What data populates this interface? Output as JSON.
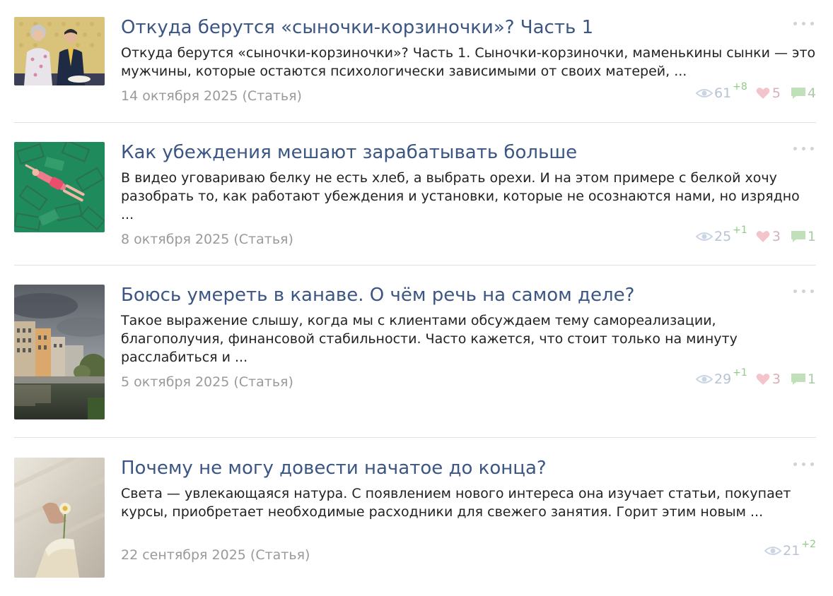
{
  "articles": [
    {
      "title": "Откуда берутся «сыночки-корзиночки»? Часть 1",
      "excerpt": "Откуда берутся «сыночки-корзиночки»? Часть 1. Сыночки-корзиночки, маменькины сынки — это мужчины, которые остаются психологически зависимыми от своих матерей, ...",
      "date": "14 октября 2025",
      "type": "(Статья)",
      "views": "61",
      "views_delta": "+8",
      "likes": "5",
      "comments": "4"
    },
    {
      "title": "Как убеждения мешают зарабатывать больше",
      "excerpt": "В видео уговариваю белку не есть хлеб, а выбрать орехи. И на этом примере с белкой хочу разобрать то, как работают убеждения и установки, которые не осознаются нами, но изрядно ...",
      "date": "8 октября 2025",
      "type": "(Статья)",
      "views": "25",
      "views_delta": "+1",
      "likes": "3",
      "comments": "1"
    },
    {
      "title": "Боюсь умереть в канаве. О чём речь на самом деле?",
      "excerpt": "Такое выражение слышу, когда мы с клиентами обсуждаем тему самореализации, благополучия, финансовой стабильности. Часто кажется, что стоит только на минуту расслабиться и ...",
      "date": "5 октября 2025",
      "type": "(Статья)",
      "views": "29",
      "views_delta": "+1",
      "likes": "3",
      "comments": "1"
    },
    {
      "title": "Почему не могу довести начатое до конца?",
      "excerpt": "Света — увлекающаяся натура. С появлением нового интереса она изучает статьи, покупает курсы, приобретает необходимые расходники для свежего занятия. Горит этим новым ...",
      "date": "22 сентября 2025",
      "type": "(Статья)",
      "views": "21",
      "views_delta": "+2"
    }
  ],
  "icons": {
    "more": "more-dots-icon",
    "views": "eye-icon",
    "likes": "heart-icon",
    "comments": "comment-icon"
  },
  "colors": {
    "title": "#3b5684",
    "text": "#222222",
    "meta": "#9a9a9a",
    "views": "#b7c3d3",
    "delta": "#8fcb83",
    "likes": "#f2b8c3",
    "comments": "#a9d3a2"
  }
}
